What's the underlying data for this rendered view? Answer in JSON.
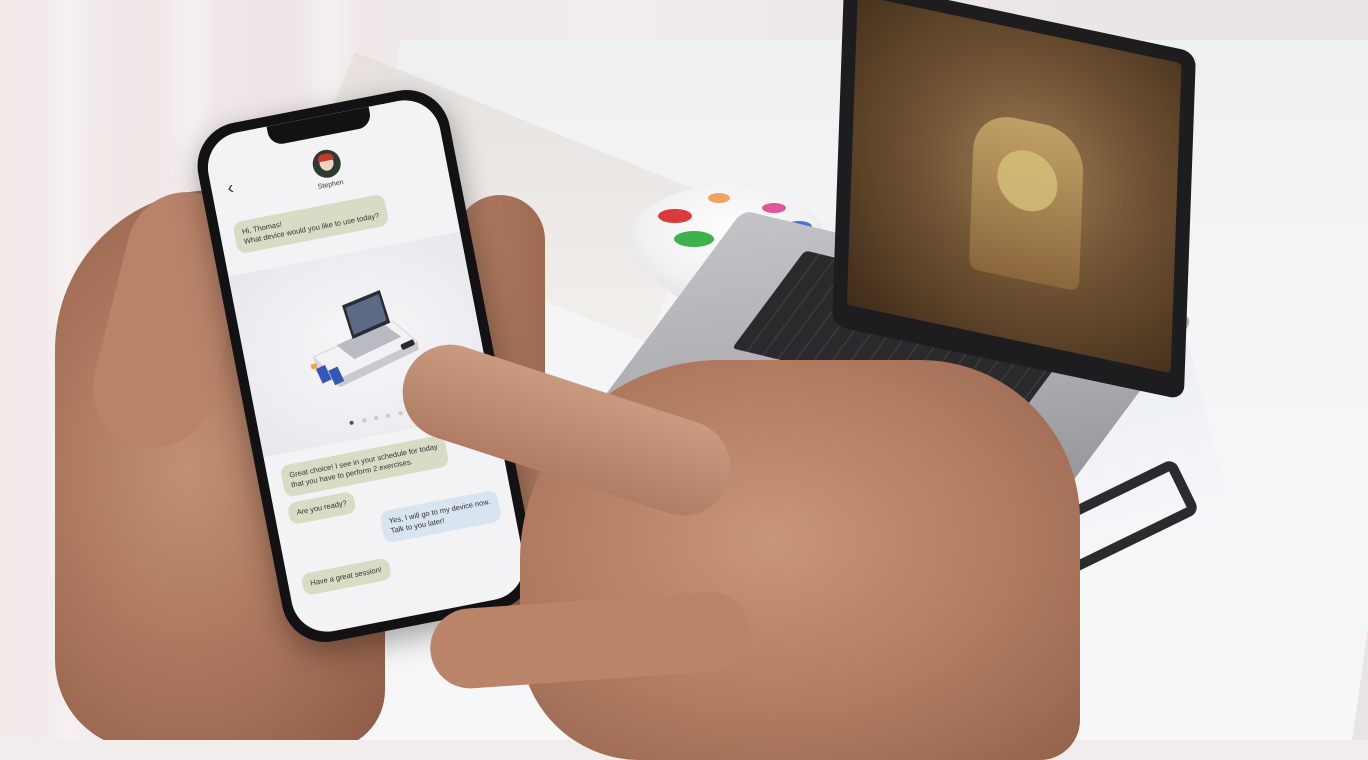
{
  "chat": {
    "contact_name": "Stephen",
    "messages": [
      {
        "from": "bot",
        "lines": [
          "Hi, Thomas!",
          "What device would you like to use today?"
        ]
      },
      {
        "from": "bot",
        "lines": [
          "Great choice! I see in your schedule for today",
          "that you have to perform 2 exercises."
        ]
      },
      {
        "from": "bot",
        "lines": [
          "Are you ready?"
        ]
      },
      {
        "from": "user",
        "lines": [
          "Yes, I will go to my device now.",
          "Talk to you later!"
        ]
      },
      {
        "from": "bot",
        "lines": [
          "Have a great session!"
        ]
      }
    ]
  },
  "carousel": {
    "slide_count": 5,
    "active_slide": 1
  },
  "icons": {
    "back": "chevron-left-icon",
    "avatar": "contact-avatar"
  },
  "colors": {
    "bot_bubble": "#d9dcc4",
    "user_bubble": "#d8e4ef",
    "phone_frame": "#121214",
    "screen_bg": "#f3f2f4"
  }
}
